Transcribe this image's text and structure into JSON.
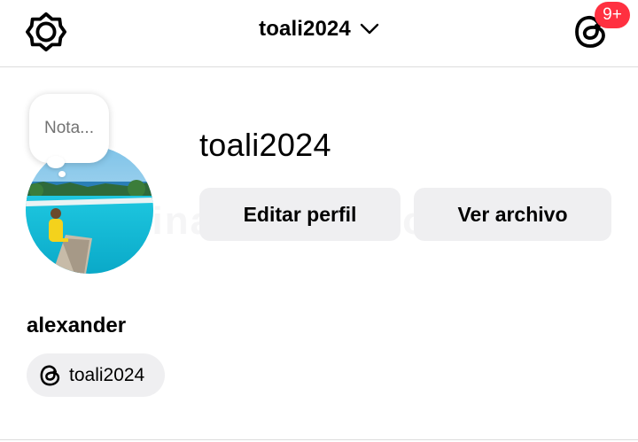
{
  "header": {
    "account_name": "toali2024",
    "notification_badge": "9+",
    "icons": [
      "settings-gear-icon",
      "chevron-down-icon",
      "threads-icon"
    ]
  },
  "profile": {
    "note_placeholder": "Nota...",
    "username": "toali2024",
    "display_name": "alexander",
    "threads_handle": "toali2024"
  },
  "actions": {
    "edit_profile": "Editar perfil",
    "view_archive": "Ver archivo"
  },
  "colors": {
    "badge": "#ff3040",
    "button_bg": "#efeff1",
    "note_text": "#737373"
  }
}
